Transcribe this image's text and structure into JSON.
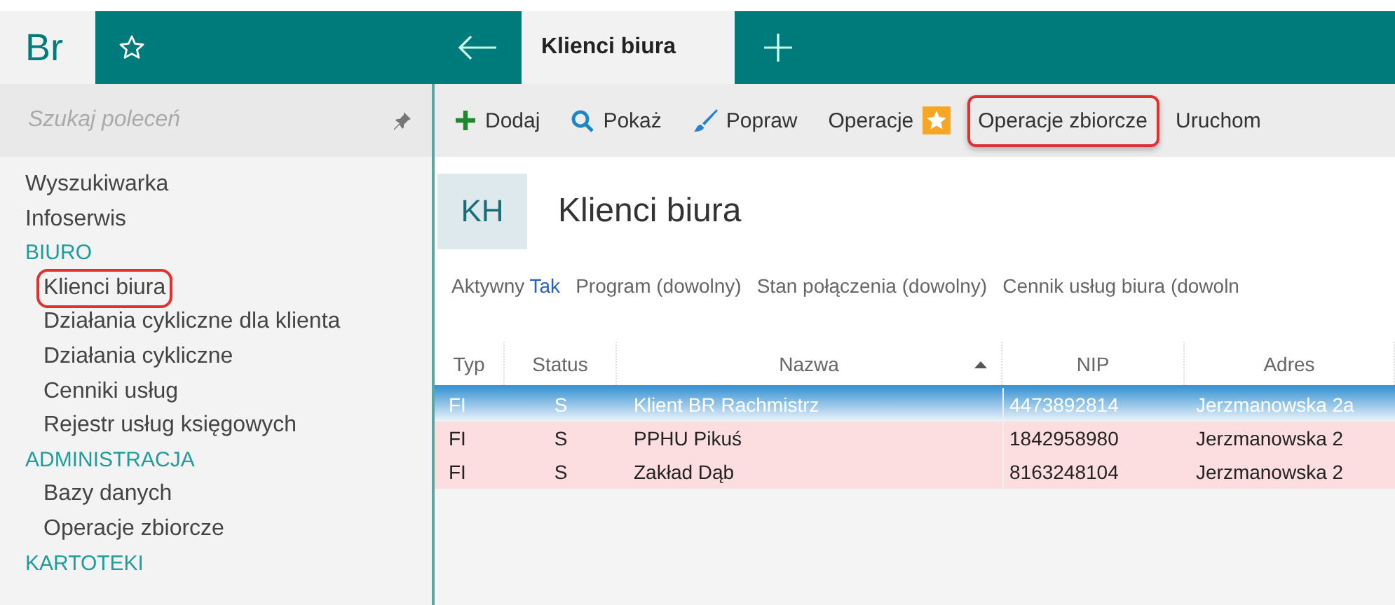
{
  "app": {
    "logo": "Br"
  },
  "tabs": [
    {
      "label": "Klienci biura",
      "selected": true
    }
  ],
  "sidebar": {
    "search": {
      "placeholder": "Szukaj poleceń"
    },
    "items": [
      {
        "kind": "link",
        "label": "Wyszukiwarka",
        "highlighted": false
      },
      {
        "kind": "link",
        "label": "Infoserwis",
        "highlighted": false
      },
      {
        "kind": "section",
        "label": "BIURO",
        "highlighted": false
      },
      {
        "kind": "sub",
        "label": "Klienci biura",
        "highlighted": true
      },
      {
        "kind": "sub",
        "label": "Działania cykliczne dla klienta",
        "highlighted": false
      },
      {
        "kind": "sub",
        "label": "Działania cykliczne",
        "highlighted": false
      },
      {
        "kind": "sub",
        "label": "Cenniki usług",
        "highlighted": false
      },
      {
        "kind": "sub",
        "label": "Rejestr usług księgowych",
        "highlighted": false
      },
      {
        "kind": "section",
        "label": "ADMINISTRACJA",
        "highlighted": false
      },
      {
        "kind": "sub",
        "label": "Bazy danych",
        "highlighted": false
      },
      {
        "kind": "sub",
        "label": "Operacje zbiorcze",
        "highlighted": false
      },
      {
        "kind": "section",
        "label": "KARTOTEKI",
        "highlighted": false
      }
    ]
  },
  "toolbar": [
    {
      "kind": "add",
      "label": "Dodaj",
      "highlighted": false
    },
    {
      "kind": "view",
      "label": "Pokaż",
      "highlighted": false
    },
    {
      "kind": "edit",
      "label": "Popraw",
      "highlighted": false
    },
    {
      "kind": "favorite",
      "label": "Operacje",
      "highlighted": false
    },
    {
      "kind": "plain",
      "label": "Operacje zbiorcze",
      "highlighted": true
    },
    {
      "kind": "plain",
      "label": "Uruchom",
      "highlighted": false
    }
  ],
  "header": {
    "code": "KH",
    "title": "Klienci biura"
  },
  "filters": [
    {
      "label": "Aktywny",
      "value": "Tak",
      "set": true
    },
    {
      "label": "Program",
      "value": "(dowolny)",
      "set": false
    },
    {
      "label": "Stan połączenia",
      "value": "(dowolny)",
      "set": false
    },
    {
      "label": "Cennik usług biura",
      "value": "(dowoln",
      "set": false
    }
  ],
  "table": {
    "columns": [
      {
        "label": "Typ",
        "sorted": false
      },
      {
        "label": "Status",
        "sorted": false
      },
      {
        "label": "Nazwa",
        "sorted": true
      },
      {
        "label": "NIP",
        "sorted": false
      },
      {
        "label": "Adres",
        "sorted": false
      }
    ],
    "rows": [
      {
        "selected": true,
        "cells": [
          "FI",
          "S",
          "Klient BR Rachmistrz",
          "4473892814",
          "Jerzmanowska 2a"
        ]
      },
      {
        "selected": false,
        "cells": [
          "FI",
          "S",
          "PPHU Pikuś",
          "1842958980",
          "Jerzmanowska 2"
        ]
      },
      {
        "selected": false,
        "cells": [
          "FI",
          "S",
          "Zakład Dąb",
          "8163248104",
          "Jerzmanowska 2"
        ]
      }
    ]
  }
}
